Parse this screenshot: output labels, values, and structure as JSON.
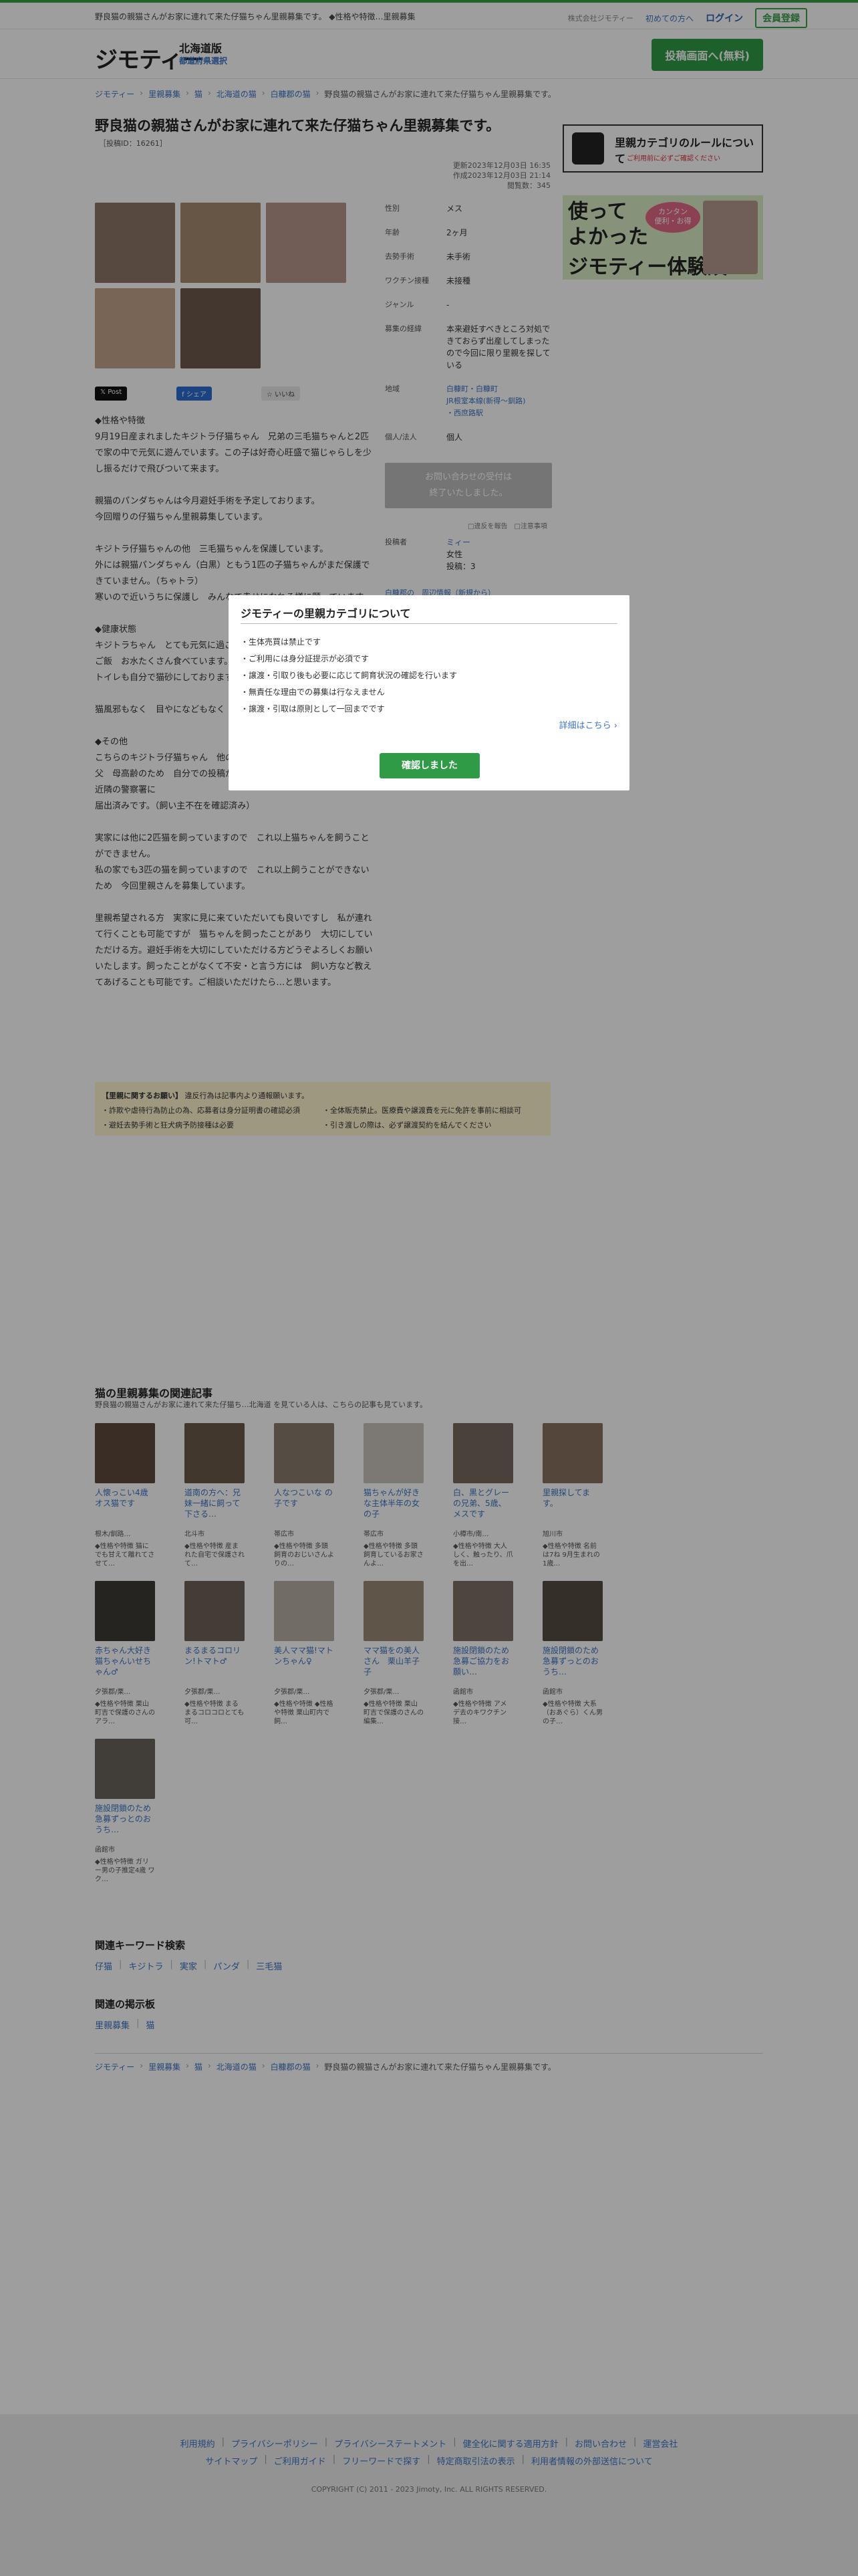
{
  "topbar": {
    "tagline": "野良猫の親猫さんがお家に連れて来た仔猫ちゃん里親募集です。 ◆性格や特徴…里親募集",
    "company": "株式会社ジモティー",
    "first_time": "初めての方へ",
    "login": "ログイン",
    "register": "会員登録"
  },
  "header": {
    "logo": "ジモティー",
    "region": "北海道版",
    "region_select": "都道府県選択",
    "post_button": "投稿画面へ(無料)"
  },
  "breadcrumb": [
    "ジモティー",
    "里親募集",
    "猫",
    "北海道の猫",
    "白糠郡の猫",
    "野良猫の親猫さんがお家に連れて来た仔猫ちゃん里親募集です。"
  ],
  "post": {
    "title": "野良猫の親猫さんがお家に連れて来た仔猫ちゃん里親募集です。",
    "id_label": "［投稿ID：16261］",
    "updated": "更新2023年12月03日 16:35",
    "created": "作成2023年12月03日 21:14",
    "views": "閲覧数：345",
    "body": "◆性格や特徴\n9月19日産まれましたキジトラ仔猫ちゃん　兄弟の三毛猫ちゃんと2匹で家の中で元気に遊んでいます。この子は好奇心旺盛で猫じゃらしを少し振るだけで飛びついて来ます。\n\n親猫のパンダちゃんは今月避妊手術を予定しております。\n今回贈りの仔猫ちゃん里親募集しています。\n\nキジトラ仔猫ちゃんの他　三毛猫ちゃんを保護しています。\n外には親猫パンダちゃん（白黒）ともう1匹の子猫ちゃんがまだ保護できていません。（ちゃトラ）\n寒いので近いうちに保護し　みんなで幸せになれる様に願っています。\n\n◆健康状態\nキジトラちゃん　とても元気に過ごしております。\nご飯　お水たくさん食べています。\nトイレも自分で猫砂にしております。\n\n猫風邪もなく　目やになどもなく　健康です。\n\n◆その他\nこちらのキジトラ仔猫ちゃん　他の家族で保護しています。\n父　母高齢のため　自分での投稿ができなく　私（娘）がしています。\n近隣の警察署に\n届出済みです。（飼い主不在を確認済み）\n\n実家には他に2匹猫を飼っていますので　これ以上猫ちゃんを飼うことができません。\n私の家でも3匹の猫を飼っていますので　これ以上飼うことができないため　今回里親さんを募集しています。\n\n里親希望される方　実家に見に来ていただいても良いですし　私が連れて行くことも可能ですが　猫ちゃんを飼ったことがあり　大切にしていただける方。避妊手術を大切にしていただける方どうぞよろしくお願いいたします。飼ったことがなくて不安・と言う方には　飼い方など教えてあげることも可能です。ご相談いただけたら…と思います。"
  },
  "specs": [
    {
      "k": "性別",
      "v": "メス"
    },
    {
      "k": "年齢",
      "v": "2ヶ月"
    },
    {
      "k": "去勢手術",
      "v": "未手術"
    },
    {
      "k": "ワクチン接種",
      "v": "未接種"
    },
    {
      "k": "ジャンル",
      "v": "-"
    },
    {
      "k": "募集の経緯",
      "v": "本来避妊すべきところ対処できておらず出産してしまったので今回に限り里親を探している"
    },
    {
      "k": "地域",
      "v": "白糠町・白糠町\nJR根室本線(新得〜釧路)\n・西庶路駅"
    },
    {
      "k": "個人/法人",
      "v": "個人"
    }
  ],
  "inquiry": {
    "line1": "お問い合わせの受付は",
    "line2": "終了いたしました。"
  },
  "report": "□違反を報告　□注意事項",
  "poster": {
    "label": "投稿者",
    "name": "ミィー",
    "gender": "女性",
    "posts": "投稿：3"
  },
  "nearby": "白糠郡の　周辺情報（新規から）",
  "side": {
    "rules_title": "里親カテゴリのルールについて",
    "rules_sub": "ご利用前に必ずご確認ください",
    "ad_line1": "使って",
    "ad_line2": "よかった",
    "ad_line3": "ジモティー体験談",
    "ad_badge1": "カンタン",
    "ad_badge2": "便利・お得"
  },
  "notice": {
    "title": "【里親に関するお願い】",
    "lead": "違反行為は記事内より通報願います。",
    "items": [
      "・詐欺や虐待行為防止の為、応募者は身分証明書の確認必須",
      "・全体販売禁止。医療費や譲渡費を元に免許を事前に相談可",
      "・避妊去勢手術と狂犬病予防接種は必要",
      "・引き渡しの際は、必ず譲渡契約を結んでください"
    ]
  },
  "related": {
    "title": "猫の里親募集の関連記事",
    "subtitle": "野良猫の親猫さんがお家に連れて来た仔猫ち…北海道 を見ている人は、こちらの記事も見ています。",
    "items": [
      {
        "title": "人懐っこい4歳オス猫です",
        "loc": "根木/釧路…",
        "desc": "◆性格や特徴 猫にでも甘えて離れてさせて…",
        "color": "#5c4a3c"
      },
      {
        "title": "道南の方へ：兄妹一緒に飼って下さる…",
        "loc": "北斗市",
        "desc": "◆性格や特徴 産まれた自宅で保護されて…",
        "color": "#6b5a49"
      },
      {
        "title": "人なつこいな の子です",
        "loc": "帯広市",
        "desc": "◆性格や特徴 多頭飼育のおじいさんよりの…",
        "color": "#8a7b6c"
      },
      {
        "title": "猫ちゃんが好きな主体半年の女の子",
        "loc": "帯広市",
        "desc": "◆性格や特徴 多頭飼育しているお家さんよ…",
        "color": "#c9c3bd"
      },
      {
        "title": "白、黒とグレーの兄弟、5歳、メスです",
        "loc": "小樽市/南…",
        "desc": "◆性格や特徴 大人しく、触ったり、爪を出…",
        "color": "#7a6a60"
      },
      {
        "title": "里親探してます。",
        "loc": "旭川市",
        "desc": "◆性格や特徴 名前は7ね 9月生まれの1歳…",
        "color": "#8a7262"
      },
      {
        "title": "赤ちゃん大好き猫ちゃんいせちゃん♂",
        "loc": "夕張郡/栗…",
        "desc": "◆性格や特徴 栗山町吉で保護のさんのアラ…",
        "color": "#3e3a36"
      },
      {
        "title": "まるまるコロリン!トマト♂",
        "loc": "夕張郡/栗…",
        "desc": "◆性格や特徴 まるまるコロコロとても可…",
        "color": "#6e6258"
      },
      {
        "title": "美人ママ猫!マトンちゃん♀",
        "loc": "夕張郡/栗…",
        "desc": "◆性格や特徴 ◆性格や特徴 栗山町内で飼…",
        "color": "#b8aea6"
      },
      {
        "title": "ママ猫をの美人さん　栗山羊子子",
        "loc": "夕張郡/栗…",
        "desc": "◆性格や特徴 栗山町吉で保護のさんの編集…",
        "color": "#9c8a76"
      },
      {
        "title": "施設閉鎖のため急募ご協力をお願い…",
        "loc": "函館市",
        "desc": "◆性格や特徴 アメデ去のキワクチン接…",
        "color": "#7e7264"
      },
      {
        "title": "施設閉鎖のため急募ずっとのおうち…",
        "loc": "函館市",
        "desc": "◆性格や特徴 大系（おあぐら）くん男の子…",
        "color": "#564c44"
      },
      {
        "title": "施設閉鎖のため急募ずっとのおうち…",
        "loc": "函館市",
        "desc": "◆性格や特徴 ガリー男の子推定4歳 ワク…",
        "color": "#6a645c"
      }
    ]
  },
  "keywords": {
    "title": "関連キーワード検索",
    "items": [
      "仔猫",
      "キジトラ",
      "実家",
      "パンダ",
      "三毛猫"
    ]
  },
  "boards": {
    "title": "関連の掲示板",
    "items": [
      "里親募集",
      "猫"
    ]
  },
  "footer": {
    "row1": [
      "利用規約",
      "プライバシーポリシー",
      "プライバシーステートメント",
      "健全化に関する適用方針",
      "お問い合わせ",
      "運営会社"
    ],
    "row2": [
      "サイトマップ",
      "ご利用ガイド",
      "フリーワードで探す",
      "特定商取引法の表示",
      "利用者情報の外部送信について"
    ],
    "copyright": "COPYRIGHT (C) 2011 - 2023 Jimoty, Inc. ALL RIGHTS RESERVED."
  },
  "modal": {
    "title": "ジモティーの里親カテゴリについて",
    "rules": [
      "・生体売買は禁止です",
      "・ご利用には身分証提示が必須です",
      "・譲渡・引取り後も必要に応じて飼育状況の確認を行います",
      "・無責任な理由での募集は行なえません",
      "・譲渡・引取は原則として一回までです"
    ],
    "more": "詳細はこちら ›",
    "confirm": "確認しました"
  },
  "colors": {
    "brand_green": "#2f9b47",
    "link_blue": "#3a74c4",
    "notice_bg": "#fff6cf"
  },
  "thumbnails": [
    "#8d7666",
    "#a78a72",
    "#b6958c",
    "#c4a48a",
    "#6c5a4c"
  ]
}
